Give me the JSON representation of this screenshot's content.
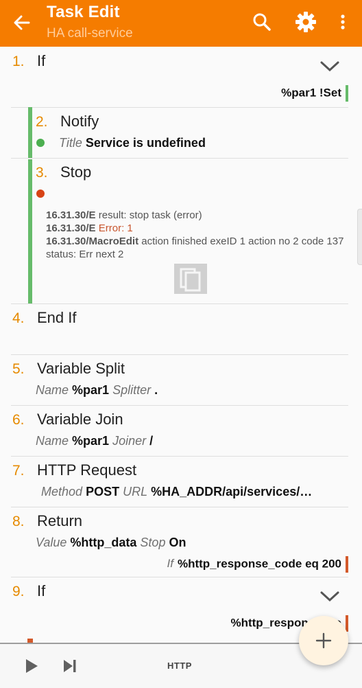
{
  "toolbar": {
    "title": "Task Edit",
    "subtitle": "HA call-service",
    "icons": [
      "arrow-back-icon",
      "search-icon",
      "gear-icon",
      "more-vert-icon"
    ],
    "color": "#f57c00"
  },
  "actions": [
    {
      "num": "1.",
      "name": "If",
      "condition": "%par1 !Set",
      "condition_color": "#66bb6a",
      "expanded": true
    },
    {
      "num": "2.",
      "name": "Notify",
      "status_color": "#4caf50",
      "params": [
        {
          "label": "Title",
          "value": "Service is undefined"
        }
      ]
    },
    {
      "num": "3.",
      "name": "Stop",
      "status_color": "#d84315",
      "log": [
        {
          "ts": "16.31.30/E",
          "text": "result: stop task (error)"
        },
        {
          "ts": "16.31.30/E",
          "text": "Error: 1"
        },
        {
          "ts": "16.31.30/MacroEdit",
          "text": "action finished exeID 1 action no 2 code 137 status: Err next 2"
        }
      ]
    },
    {
      "num": "4.",
      "name": "End If"
    },
    {
      "num": "5.",
      "name": "Variable Split",
      "params": [
        {
          "label": "Name",
          "value": "%par1"
        },
        {
          "label": "Splitter",
          "value": "."
        }
      ]
    },
    {
      "num": "6.",
      "name": "Variable Join",
      "params": [
        {
          "label": "Name",
          "value": "%par1"
        },
        {
          "label": "Joiner",
          "value": "/"
        }
      ]
    },
    {
      "num": "7.",
      "name": "HTTP Request",
      "params": [
        {
          "label": "Method",
          "value": "POST"
        },
        {
          "label": "URL",
          "value": "%HA_ADDR/api/services/…"
        }
      ]
    },
    {
      "num": "8.",
      "name": "Return",
      "params": [
        {
          "label": "Value",
          "value": "%http_data"
        },
        {
          "label": "Stop",
          "value": "On"
        }
      ],
      "condition_label": "If",
      "condition": "%http_response_code eq 200",
      "condition_color": "#d35a2b"
    },
    {
      "num": "9.",
      "name": "If",
      "condition": "%http_response_co",
      "condition_color": "#d35a2b",
      "expanded": true
    }
  ],
  "bottom": {
    "label": "HTTP",
    "icons": [
      "play-icon",
      "skip-next-icon"
    ],
    "fab_icon": "plus-icon"
  }
}
